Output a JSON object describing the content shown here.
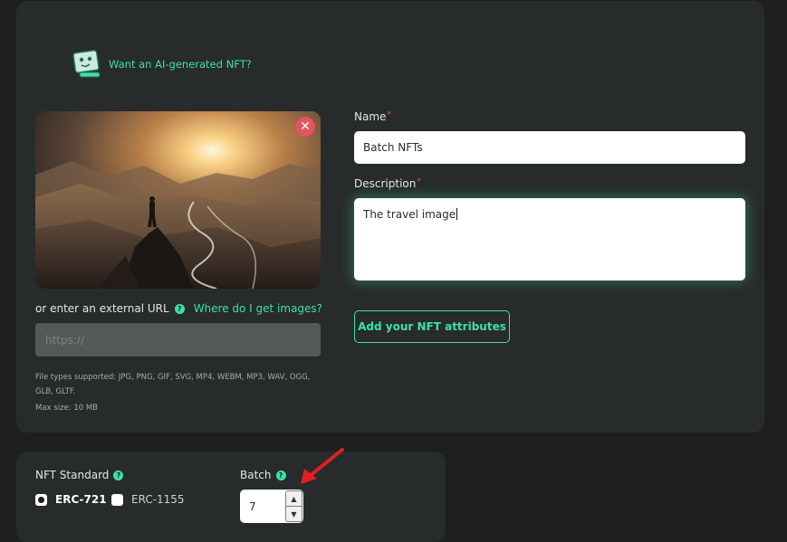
{
  "ai_prompt": {
    "link_text": "Want an AI-generated NFT?"
  },
  "media": {
    "remove_icon": "close-icon",
    "external_url_label": "or enter an external URL",
    "help_link": "Where do I get images?",
    "url_placeholder": "https://",
    "file_types": "File types supported: JPG, PNG, GIF, SVG, MP4, WEBM, MP3, WAV, OGG, GLB, GLTF.",
    "max_size": "Max size: 10 MB"
  },
  "form": {
    "name_label": "Name",
    "name_value": "Batch NFTs",
    "description_label": "Description",
    "description_value": "The travel image",
    "required_mark": "*",
    "attributes_button": "Add your NFT attributes"
  },
  "settings": {
    "standard_label": "NFT Standard",
    "standard_options": [
      "ERC-721",
      "ERC-1155"
    ],
    "standard_selected": "ERC-721",
    "batch_label": "Batch",
    "batch_value": "7",
    "help_glyph": "?"
  },
  "colors": {
    "accent": "#3ee0a8",
    "background": "#1e2020",
    "panel": "#272b2b",
    "required": "#e2555f",
    "annotation_arrow": "#e02020"
  }
}
